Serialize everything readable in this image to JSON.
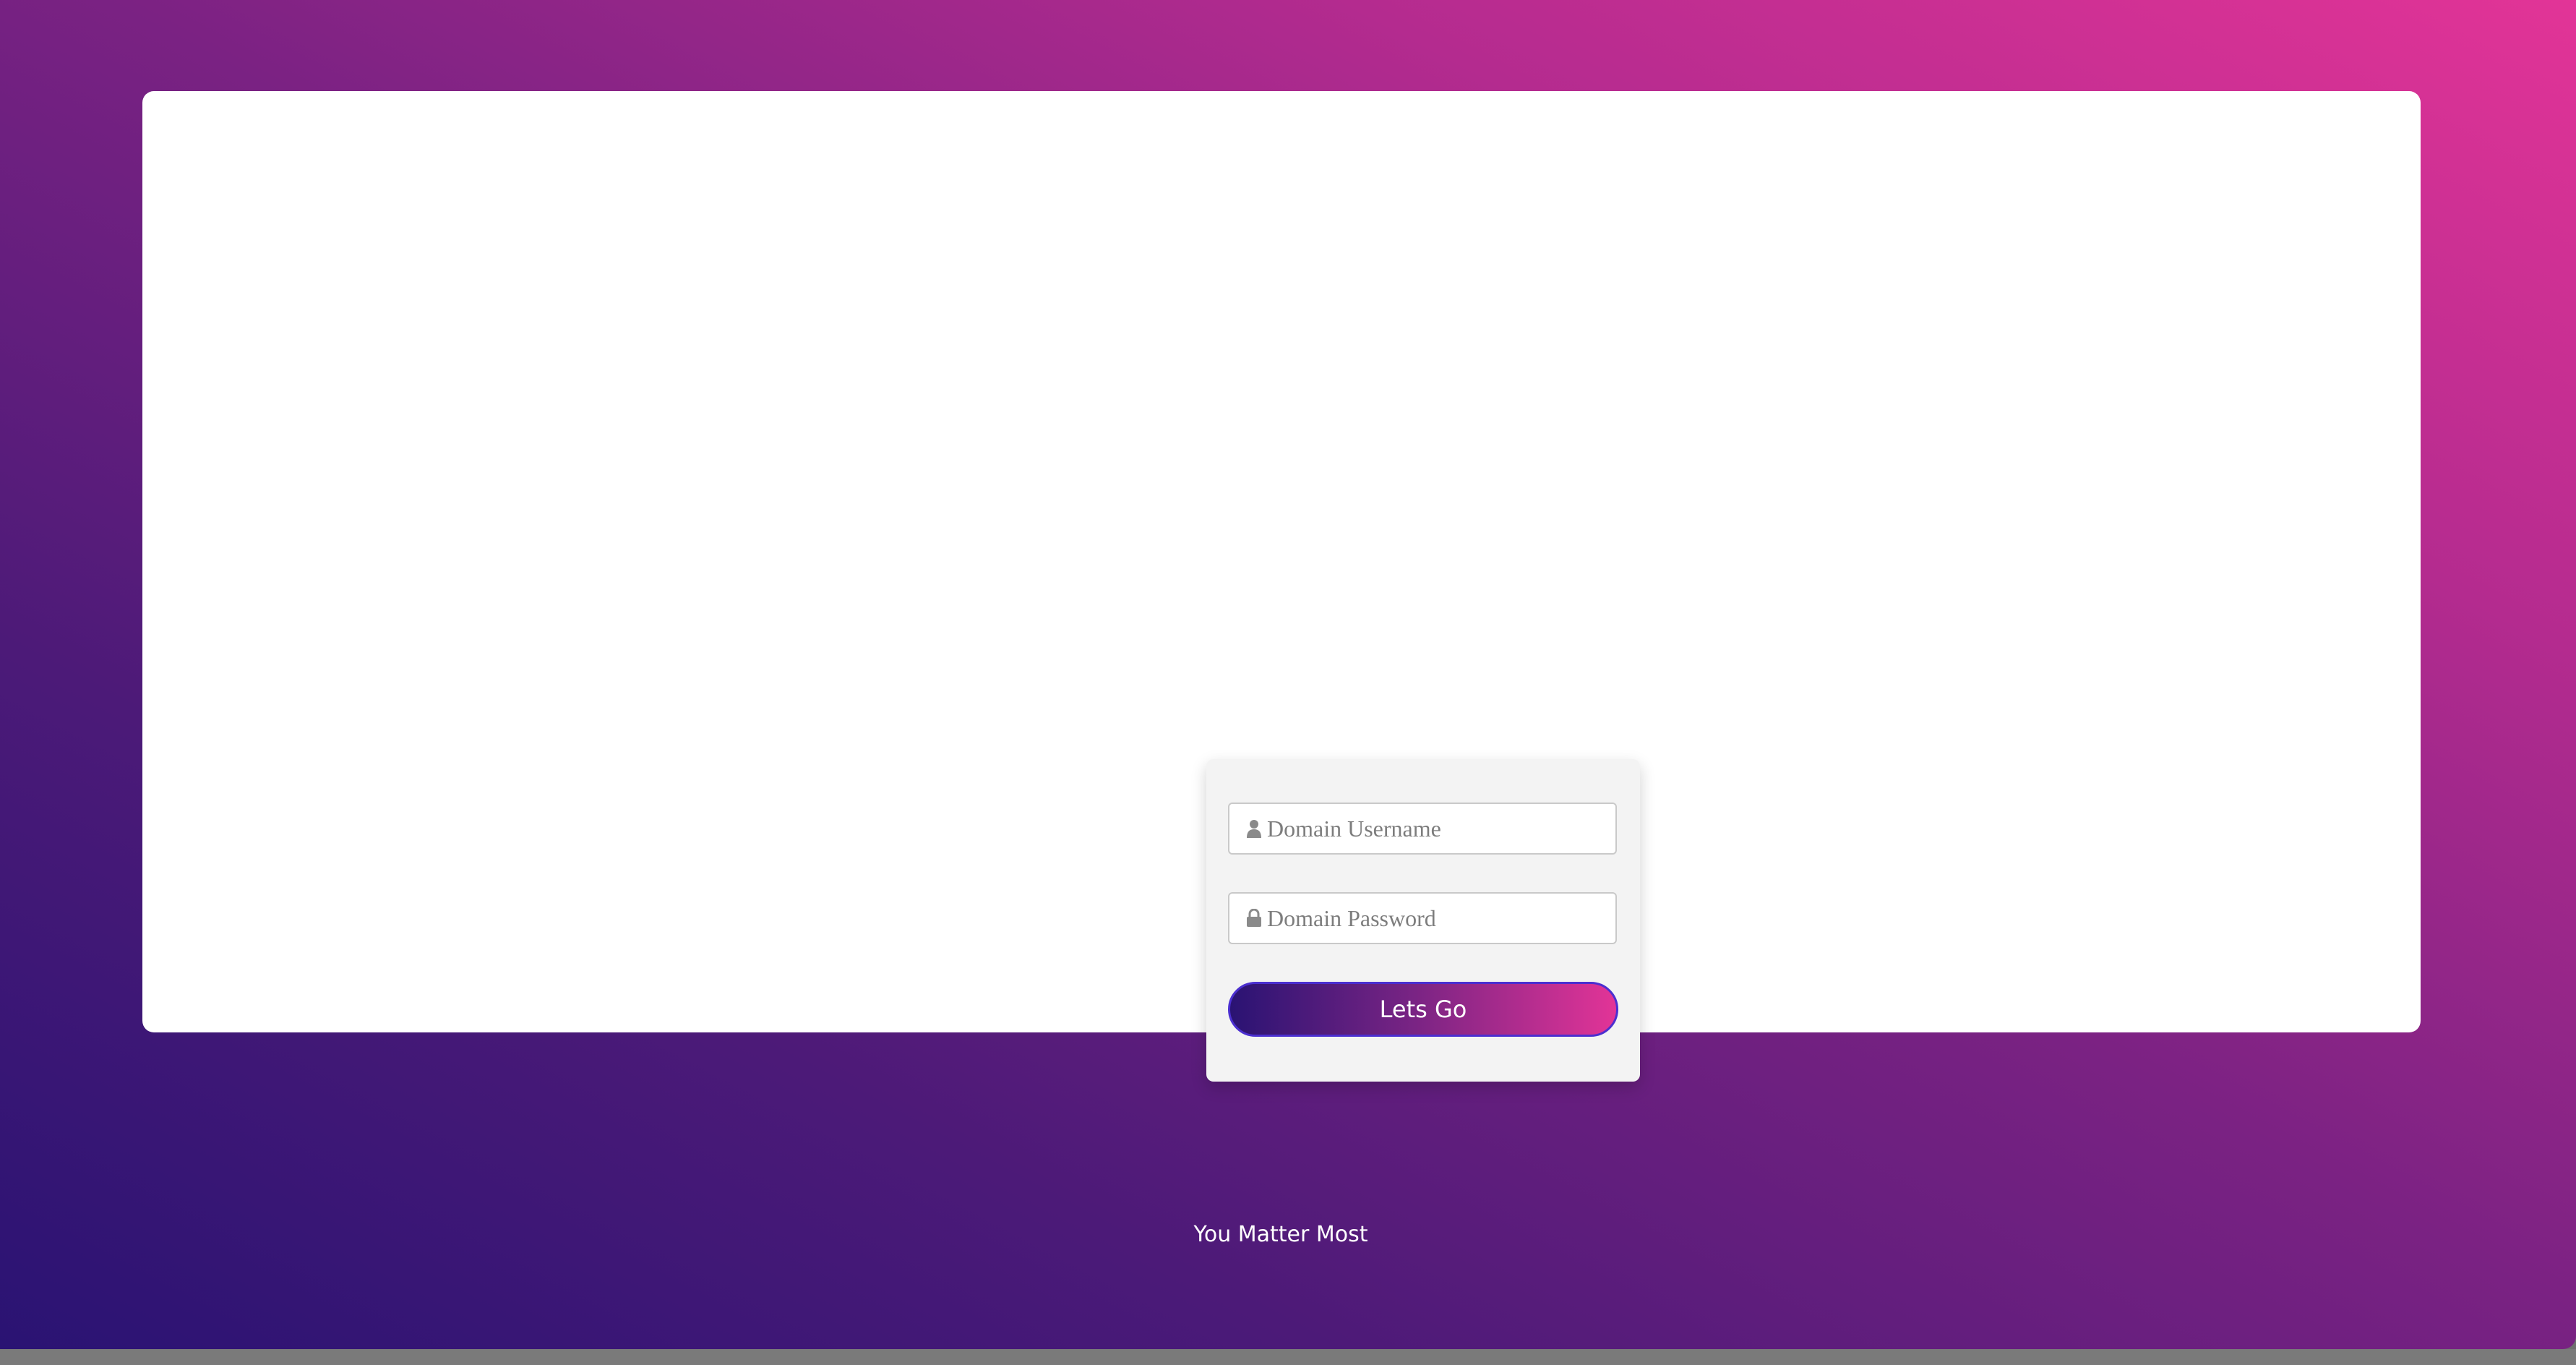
{
  "login": {
    "username_placeholder": "Domain Username",
    "password_placeholder": "Domain Password",
    "submit_label": "Lets Go",
    "username_icon": "user-icon",
    "password_icon": "lock-icon"
  },
  "footer": {
    "tagline": "You Matter Most"
  },
  "colors": {
    "gradient_start": "#2a1373",
    "gradient_end": "#e23497",
    "panel_background": "#ffffff",
    "card_background": "#f3f3f3",
    "button_border": "#4b2fd0"
  }
}
